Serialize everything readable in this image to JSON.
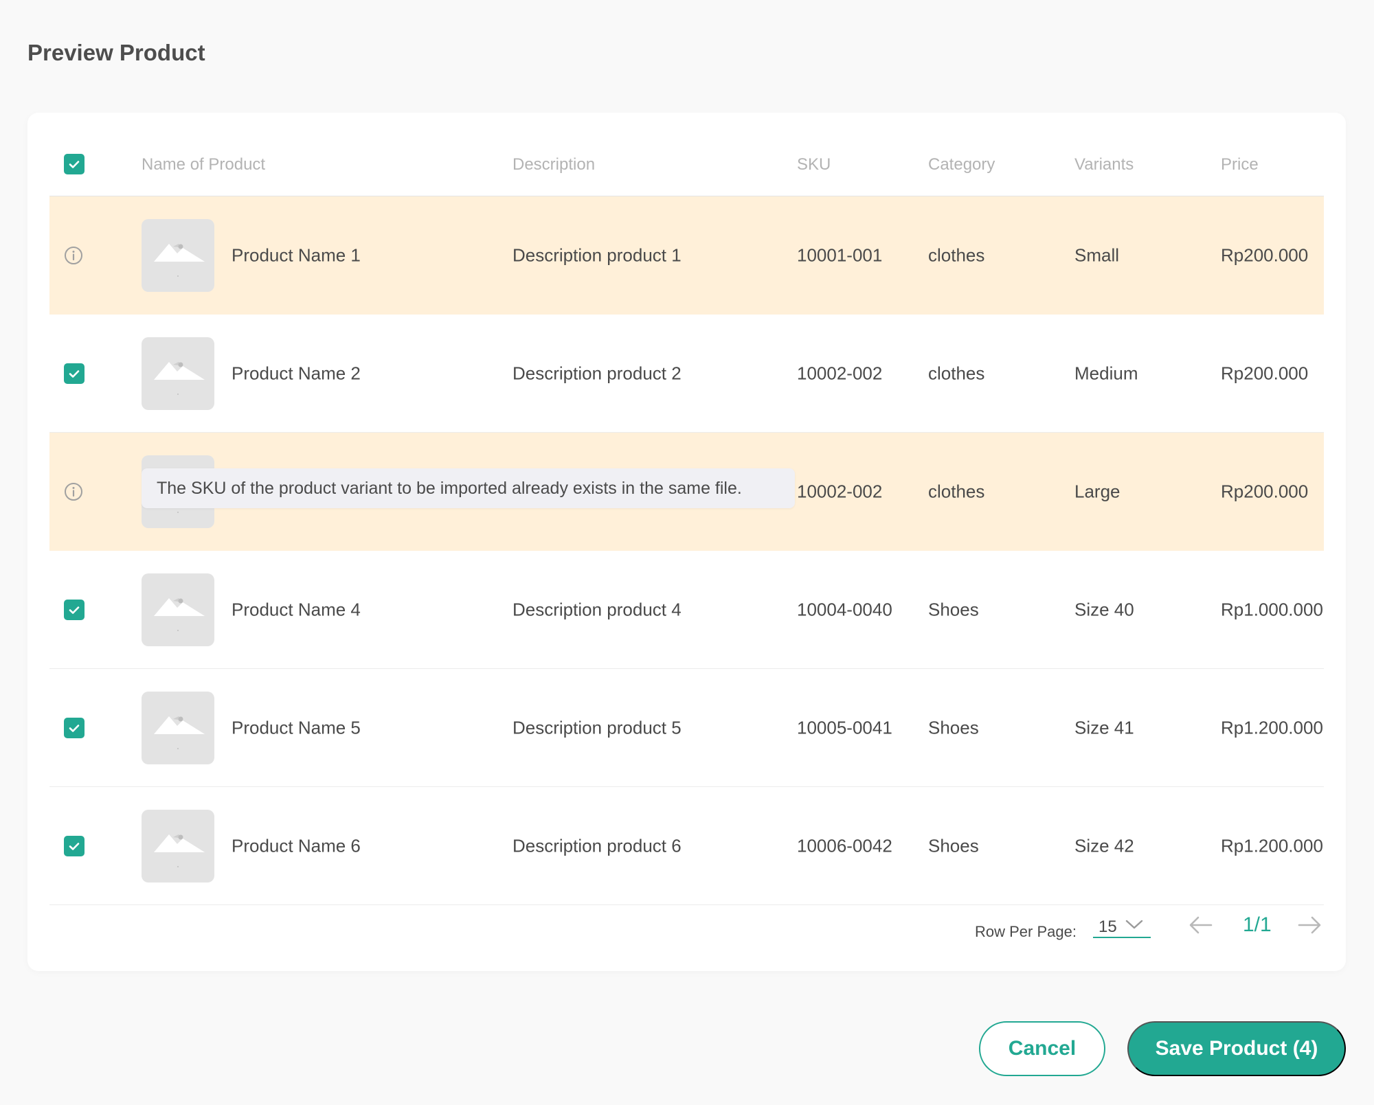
{
  "page": {
    "title": "Preview Product"
  },
  "table": {
    "columns": [
      "Name of Product",
      "Description",
      "SKU",
      "Category",
      "Variants",
      "Price"
    ],
    "rows": [
      {
        "status": "warning",
        "name": "Product Name 1",
        "description": "Description product 1",
        "sku": "10001-001",
        "category": "clothes",
        "variant": "Small",
        "price": "Rp200.000"
      },
      {
        "status": "checked",
        "name": "Product Name 2",
        "description": "Description product 2",
        "sku": "10002-002",
        "category": "clothes",
        "variant": "Medium",
        "price": "Rp200.000"
      },
      {
        "status": "warning",
        "name": "",
        "description": "",
        "sku": "10002-002",
        "category": "clothes",
        "variant": "Large",
        "price": "Rp200.000",
        "tooltip": "The SKU of the product variant to be imported already exists in the same file."
      },
      {
        "status": "checked",
        "name": "Product Name 4",
        "description": "Description product 4",
        "sku": "10004-0040",
        "category": "Shoes",
        "variant": "Size 40",
        "price": "Rp1.000.000"
      },
      {
        "status": "checked",
        "name": "Product Name 5",
        "description": "Description product 5",
        "sku": "10005-0041",
        "category": "Shoes",
        "variant": "Size 41",
        "price": "Rp1.200.000"
      },
      {
        "status": "checked",
        "name": "Product Name 6",
        "description": "Description product 6",
        "sku": "10006-0042",
        "category": "Shoes",
        "variant": "Size 42",
        "price": "Rp1.200.000"
      }
    ]
  },
  "pagination": {
    "rows_per_page_label": "Row Per Page:",
    "rows_per_page_value": "15",
    "page_indicator": "1/1"
  },
  "actions": {
    "cancel_label": "Cancel",
    "save_label": "Save Product (4)"
  },
  "colors": {
    "accent": "#22a892",
    "warning_row": "#fff0d9"
  }
}
